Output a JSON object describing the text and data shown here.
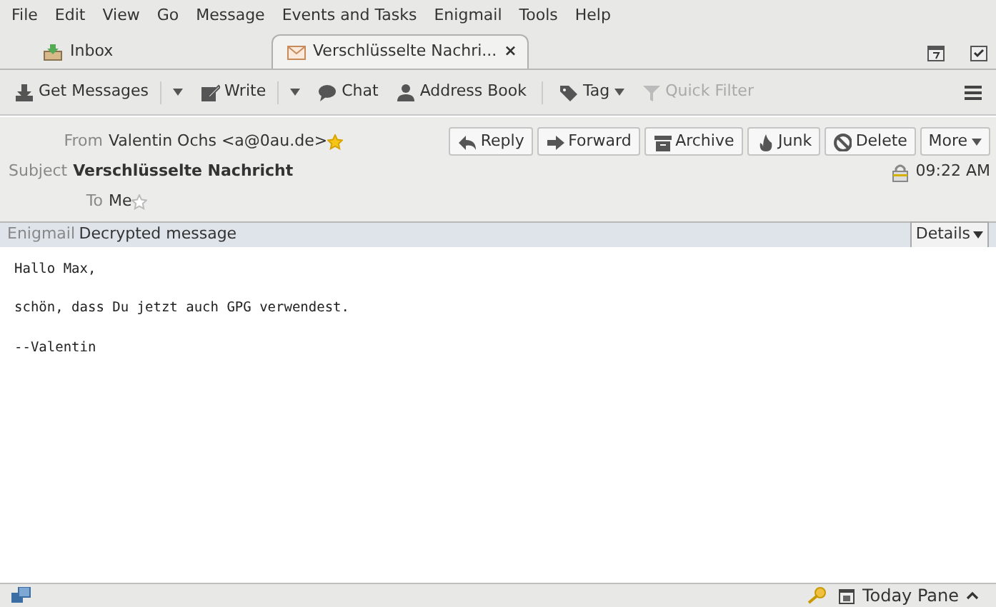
{
  "menu": [
    {
      "label": "File"
    },
    {
      "label": "Edit"
    },
    {
      "label": "View"
    },
    {
      "label": "Go"
    },
    {
      "label": "Message"
    },
    {
      "label": "Events and Tasks"
    },
    {
      "label": "Enigmail"
    },
    {
      "label": "Tools"
    },
    {
      "label": "Help"
    }
  ],
  "tabs": [
    {
      "label": "Inbox",
      "kind": "folder",
      "selected": false
    },
    {
      "label": "Verschlüsselte Nachri...",
      "kind": "message",
      "selected": true,
      "close": "×"
    }
  ],
  "toolbar": [
    {
      "label": "Get Messages",
      "dropdown": true,
      "disabled": false
    },
    {
      "label": "Write",
      "dropdown": true,
      "disabled": false
    },
    {
      "label": "Chat",
      "dropdown": false,
      "disabled": false
    },
    {
      "label": "Address Book",
      "dropdown": false,
      "disabled": false
    },
    {
      "label": "Tag",
      "dropdown": true,
      "disabled": false
    },
    {
      "label": "Quick Filter",
      "dropdown": false,
      "disabled": true
    }
  ],
  "header": {
    "from_label": "From",
    "from": "Valentin Ochs <a@0au.de>",
    "from_starred": true,
    "subject_label": "Subject",
    "subject": "Verschlüsselte Nachricht",
    "to_label": "To",
    "to": "Me",
    "to_starred": false,
    "time": "09:22 AM",
    "encrypted": true,
    "actions": [
      {
        "label": "Reply"
      },
      {
        "label": "Forward"
      },
      {
        "label": "Archive"
      },
      {
        "label": "Junk"
      },
      {
        "label": "Delete"
      },
      {
        "label": "More"
      }
    ]
  },
  "enigmail": {
    "label": "Enigmail",
    "message": "Decrypted message",
    "details": "Details"
  },
  "body": [
    "Hallo Max,",
    "schön, dass Du jetzt auch GPG verwendest.",
    "--Valentin"
  ],
  "status_bar": {
    "today_pane": "Today Pane"
  }
}
